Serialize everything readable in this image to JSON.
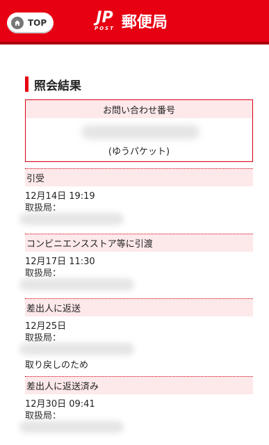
{
  "header": {
    "top_label": "TOP",
    "logo_mark": "JP",
    "logo_sub": "POST",
    "logo_text": "郵便局",
    "brand_color": "#e60012"
  },
  "section": {
    "title": "照会結果"
  },
  "inquiry": {
    "label": "お問い合わせ番号",
    "service": "(ゆうパケット)"
  },
  "events": [
    {
      "status": "引受",
      "datetime": "12月14日 19:19",
      "office_label": "取扱局："
    },
    {
      "status": "コンビニエンスストア等に引渡",
      "datetime": "12月17日 11:30",
      "office_label": "取扱局："
    },
    {
      "status": "差出人に返送",
      "datetime": "12月25日",
      "office_label": "取扱局：",
      "note": "取り戻しのため"
    },
    {
      "status": "差出人に返送済み",
      "datetime": "12月30日 09:41",
      "office_label": "取扱局："
    }
  ]
}
